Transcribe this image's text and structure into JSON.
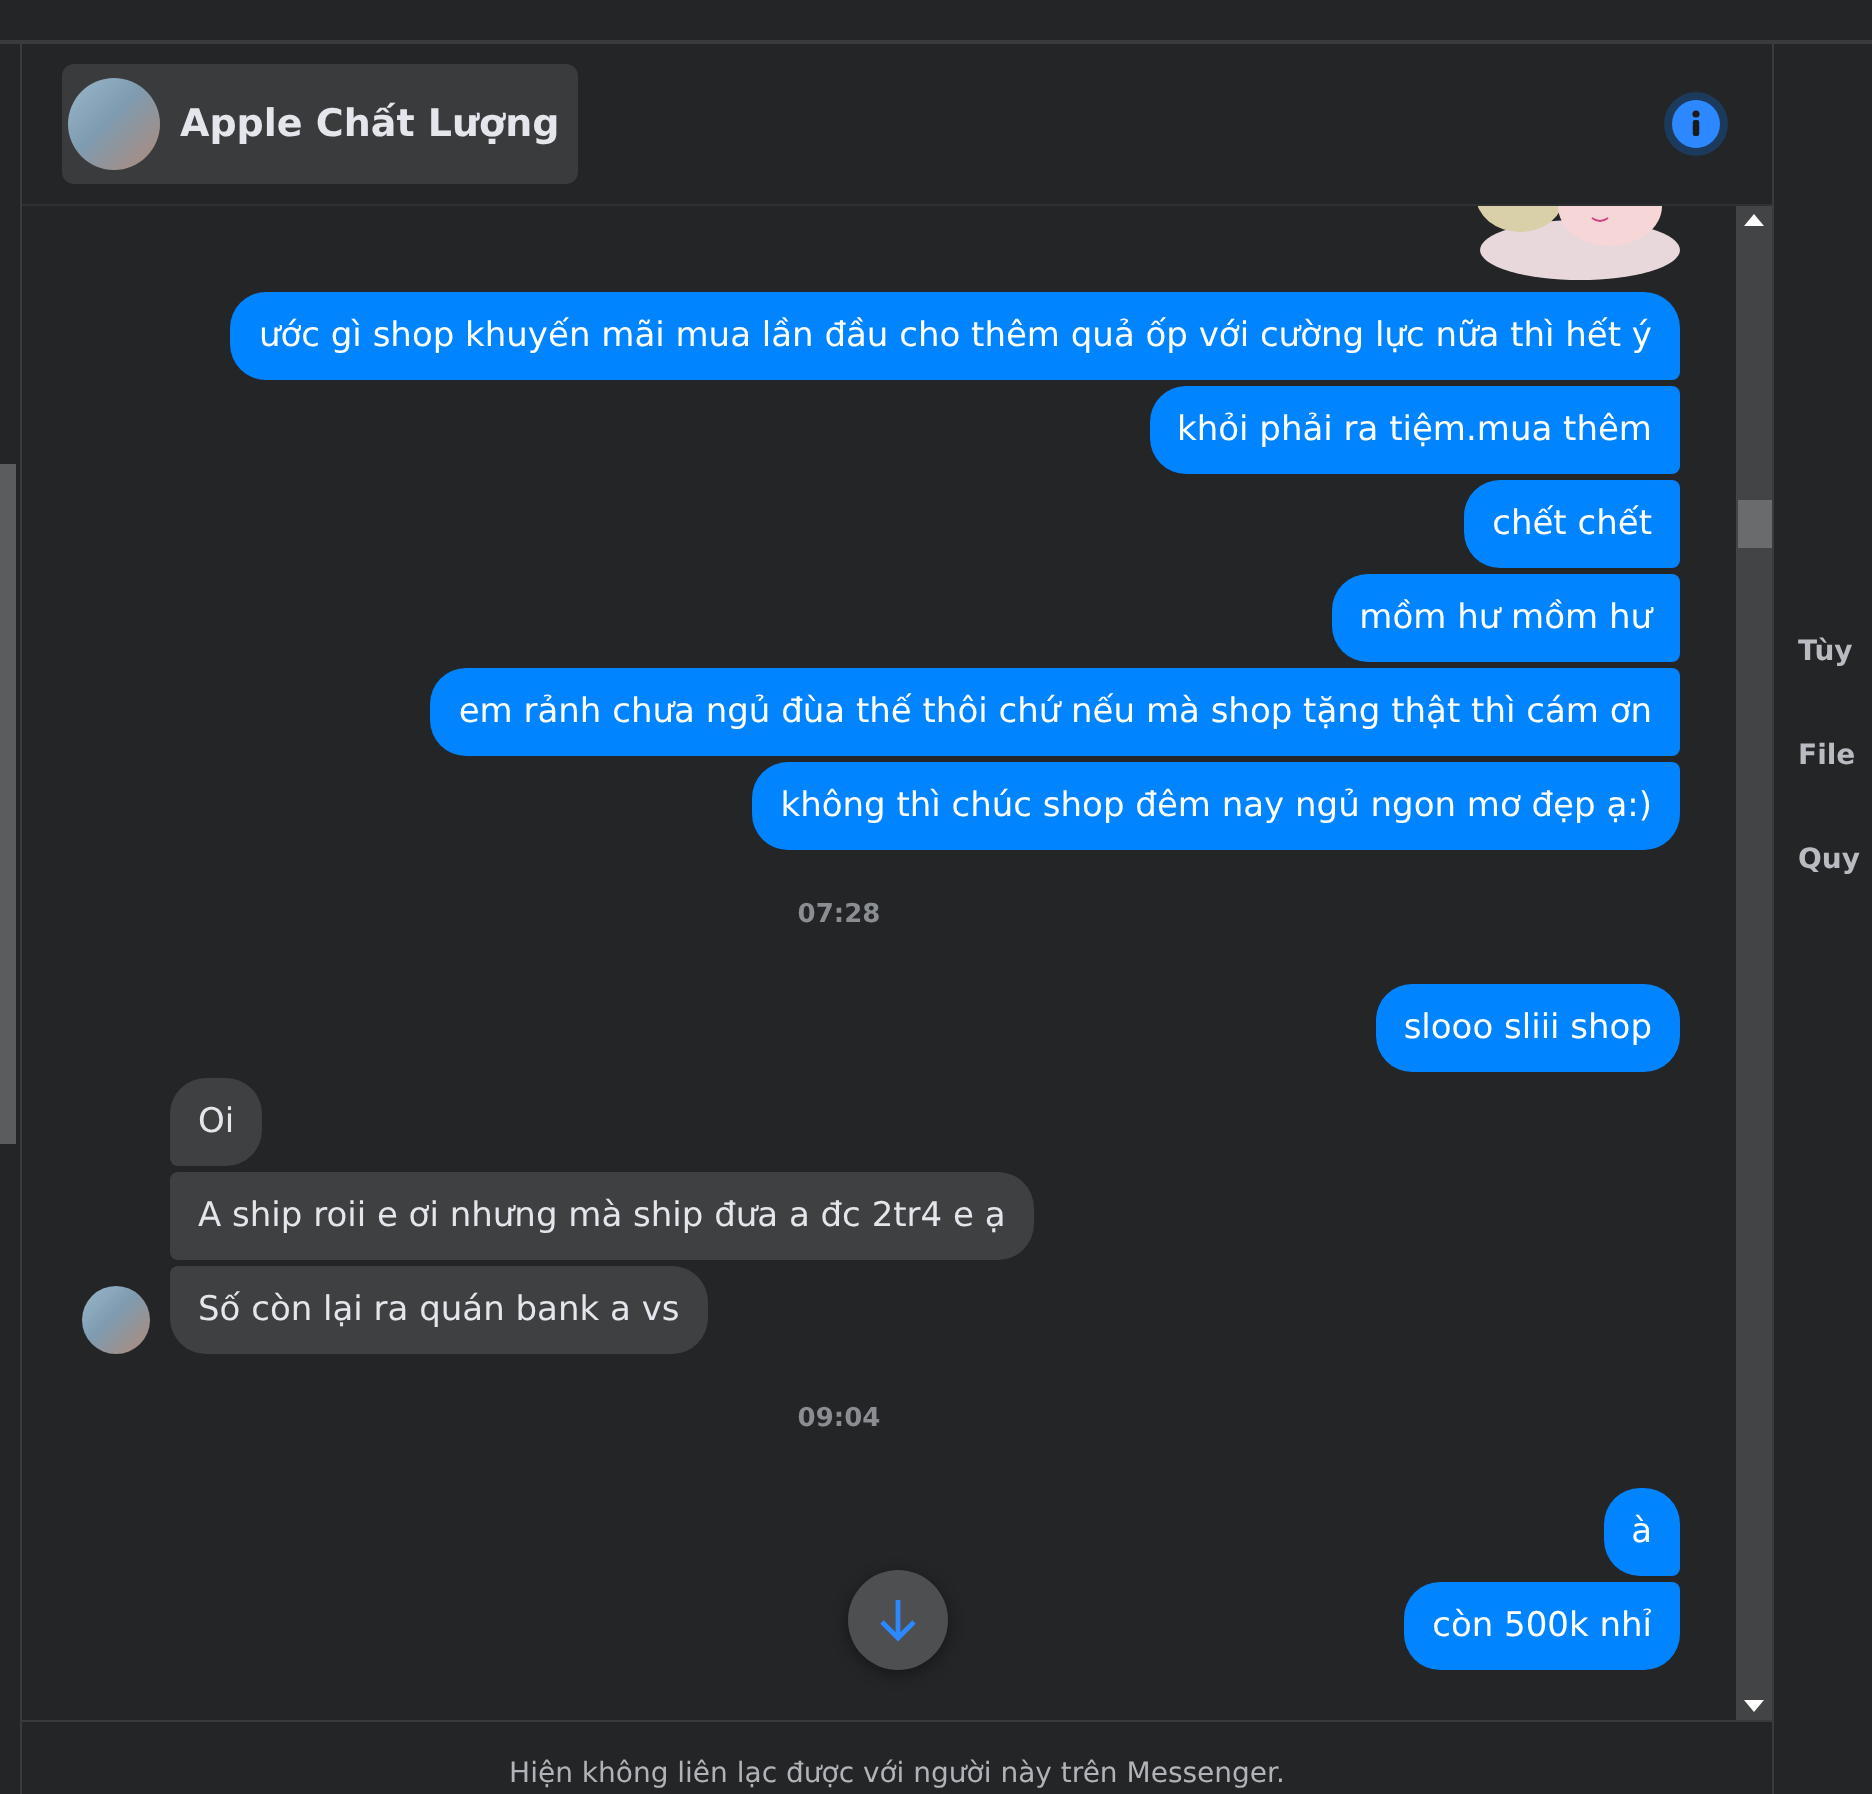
{
  "header": {
    "name": "Apple Chất Lượng"
  },
  "messages": [
    {
      "kind": "sticker"
    },
    {
      "kind": "sent",
      "text": "ước gì shop khuyến mãi mua lần đầu cho thêm quả ốp với cường lực nữa thì hết ý"
    },
    {
      "kind": "sent",
      "text": "khỏi phải ra tiệm.mua thêm"
    },
    {
      "kind": "sent",
      "text": "chết chết"
    },
    {
      "kind": "sent",
      "text": "mồm hư mồm hư"
    },
    {
      "kind": "sent",
      "text": "em rảnh chưa ngủ đùa thế thôi chứ nếu mà shop tặng thật thì cám ơn"
    },
    {
      "kind": "sent",
      "text": "không thì chúc shop đêm nay ngủ ngon mơ đẹp ạ:)"
    },
    {
      "kind": "time",
      "text": "07:28"
    },
    {
      "kind": "sent",
      "text": "slooo sliii shop"
    },
    {
      "kind": "received",
      "text": "Oi"
    },
    {
      "kind": "received",
      "text": "A ship roii e ơi nhưng mà ship đưa a đc 2tr4 e ạ"
    },
    {
      "kind": "received",
      "text": "Số còn lại ra quán bank a vs"
    },
    {
      "kind": "time",
      "text": "09:04"
    },
    {
      "kind": "sent",
      "text": "à"
    },
    {
      "kind": "sent",
      "text": "còn 500k nhỉ"
    }
  ],
  "side_panel": {
    "items": [
      "Tùy",
      "File",
      "Quy"
    ]
  },
  "footer": {
    "notice": "Hiện không liên lạc được với người này trên Messenger."
  }
}
